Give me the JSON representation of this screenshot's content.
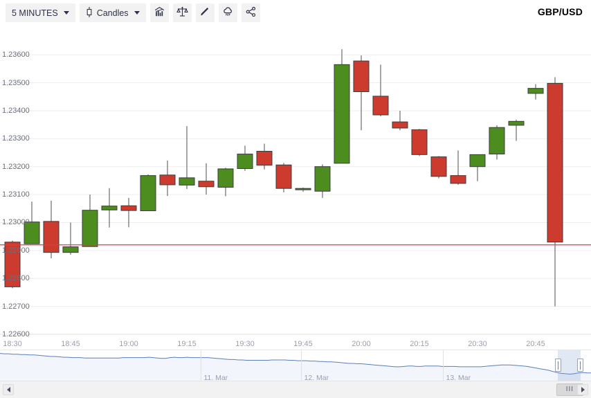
{
  "toolbar": {
    "timeframe_label": "5 MINUTES",
    "chart_type_label": "Candles",
    "chart_type_icon": "candlestick-icon",
    "buttons": [
      {
        "name": "indicators-button",
        "icon": "indicators-chart-icon"
      },
      {
        "name": "compare-button",
        "icon": "balance-scale-icon"
      },
      {
        "name": "draw-button",
        "icon": "pencil-icon"
      },
      {
        "name": "alerts-button",
        "icon": "cloud-rain-icon"
      },
      {
        "name": "share-button",
        "icon": "share-icon"
      }
    ]
  },
  "header": {
    "title": "GBP/USD"
  },
  "navigator": {
    "dates": [
      "11. Mar",
      "12. Mar",
      "13. Mar"
    ],
    "selection_start_pct": 94.4,
    "selection_end_pct": 98.2
  },
  "scrollbar": {
    "left_arrow": "scroll-left-arrow",
    "right_arrow": "scroll-right-arrow",
    "thumb_grip": "III"
  },
  "chart_data": {
    "type": "candlestick",
    "title": "GBP/USD",
    "xlabel": "",
    "ylabel": "",
    "ylim": [
      1.226,
      1.2365
    ],
    "ytick_values": [
      1.236,
      1.235,
      1.234,
      1.233,
      1.232,
      1.231,
      1.23,
      1.229,
      1.228,
      1.227,
      1.226
    ],
    "ytick_labels": [
      "1.23600",
      "1.23500",
      "1.23400",
      "1.23300",
      "1.23200",
      "1.23100",
      "1.23000",
      "1.22900",
      "1.22800",
      "1.22700",
      "1.22600"
    ],
    "xtick_labels": [
      "18:30",
      "18:45",
      "19:00",
      "19:15",
      "19:30",
      "19:45",
      "20:00",
      "20:15",
      "20:30",
      "20:45"
    ],
    "xtick_positions": [
      18,
      102,
      186,
      270,
      354,
      438,
      522,
      606,
      690,
      774
    ],
    "grid": true,
    "legend": false,
    "up_color": "#4d8c1f",
    "down_color": "#cd3a2e",
    "wick_color": "#6b6b6b",
    "border_color": "#3c3c3c",
    "current_price_line": 1.2292,
    "current_price_line_color": "#d4433a",
    "candles": [
      {
        "time": "18:30",
        "open": 1.2293,
        "high": 1.22935,
        "low": 1.22765,
        "close": 1.2277
      },
      {
        "time": "18:35",
        "open": 1.22924,
        "high": 1.23075,
        "low": 1.22924,
        "close": 1.23002
      },
      {
        "time": "18:40",
        "open": 1.23004,
        "high": 1.23078,
        "low": 1.22872,
        "close": 1.22893
      },
      {
        "time": "18:45",
        "open": 1.22893,
        "high": 1.23,
        "low": 1.22885,
        "close": 1.22913
      },
      {
        "time": "18:50",
        "open": 1.22914,
        "high": 1.231,
        "low": 1.22914,
        "close": 1.23044
      },
      {
        "time": "18:55",
        "open": 1.23045,
        "high": 1.23123,
        "low": 1.22982,
        "close": 1.23059
      },
      {
        "time": "19:00",
        "open": 1.2306,
        "high": 1.23088,
        "low": 1.22983,
        "close": 1.23043
      },
      {
        "time": "19:05",
        "open": 1.23042,
        "high": 1.23172,
        "low": 1.23042,
        "close": 1.23168
      },
      {
        "time": "19:10",
        "open": 1.2317,
        "high": 1.23222,
        "low": 1.23095,
        "close": 1.23135
      },
      {
        "time": "19:15",
        "open": 1.23134,
        "high": 1.23345,
        "low": 1.2312,
        "close": 1.2316
      },
      {
        "time": "19:20",
        "open": 1.23148,
        "high": 1.23212,
        "low": 1.231,
        "close": 1.23128
      },
      {
        "time": "19:25",
        "open": 1.23126,
        "high": 1.23196,
        "low": 1.23094,
        "close": 1.23192
      },
      {
        "time": "19:30",
        "open": 1.23193,
        "high": 1.23275,
        "low": 1.23185,
        "close": 1.23245
      },
      {
        "time": "19:35",
        "open": 1.23255,
        "high": 1.23282,
        "low": 1.2319,
        "close": 1.23205
      },
      {
        "time": "19:40",
        "open": 1.23206,
        "high": 1.23213,
        "low": 1.23108,
        "close": 1.23122
      },
      {
        "time": "19:45",
        "open": 1.23118,
        "high": 1.23125,
        "low": 1.2311,
        "close": 1.23122
      },
      {
        "time": "19:50",
        "open": 1.23112,
        "high": 1.23208,
        "low": 1.23088,
        "close": 1.232
      },
      {
        "time": "19:55",
        "open": 1.23212,
        "high": 1.2362,
        "low": 1.23212,
        "close": 1.23565
      },
      {
        "time": "20:00",
        "open": 1.23578,
        "high": 1.23598,
        "low": 1.2333,
        "close": 1.23468
      },
      {
        "time": "20:05",
        "open": 1.23452,
        "high": 1.23565,
        "low": 1.2338,
        "close": 1.23385
      },
      {
        "time": "20:10",
        "open": 1.2336,
        "high": 1.234,
        "low": 1.2333,
        "close": 1.23338
      },
      {
        "time": "20:15",
        "open": 1.23332,
        "high": 1.23335,
        "low": 1.23238,
        "close": 1.23243
      },
      {
        "time": "20:20",
        "open": 1.23235,
        "high": 1.23238,
        "low": 1.23158,
        "close": 1.23165
      },
      {
        "time": "20:25",
        "open": 1.23168,
        "high": 1.23258,
        "low": 1.23135,
        "close": 1.2314
      },
      {
        "time": "20:30",
        "open": 1.232,
        "high": 1.23228,
        "low": 1.23148,
        "close": 1.23243
      },
      {
        "time": "20:35",
        "open": 1.23245,
        "high": 1.23348,
        "low": 1.23225,
        "close": 1.2334
      },
      {
        "time": "20:40",
        "open": 1.23348,
        "high": 1.23368,
        "low": 1.23292,
        "close": 1.23362
      },
      {
        "time": "20:45",
        "open": 1.23462,
        "high": 1.23495,
        "low": 1.2344,
        "close": 1.2348
      },
      {
        "time": "20:50",
        "open": 1.23498,
        "high": 1.2352,
        "low": 1.227,
        "close": 1.2293
      }
    ],
    "navigator_series": {
      "name": "GBP/USD 3-day",
      "y_min": 1.228,
      "y_max": 1.2345,
      "values": [
        1.2344,
        1.2343,
        1.2343,
        1.2342,
        1.2342,
        1.2341,
        1.2341,
        1.234,
        1.234,
        1.2339,
        1.2338,
        1.2337,
        1.2336,
        1.2336,
        1.2335,
        1.2334,
        1.2334,
        1.2333,
        1.2333,
        1.2333,
        1.2332,
        1.2332,
        1.2332,
        1.2332,
        1.2332,
        1.2332,
        1.2332,
        1.2332,
        1.2332,
        1.2333,
        1.2333,
        1.2333,
        1.2333,
        1.2333,
        1.2333,
        1.2334,
        1.2333,
        1.2332,
        1.2331,
        1.2331,
        1.2333,
        1.2334,
        1.2333,
        1.2333,
        1.2334,
        1.2333,
        1.2333,
        1.2333,
        1.2333,
        1.2333,
        1.2332,
        1.2331,
        1.233,
        1.2329,
        1.2328,
        1.2328,
        1.2327,
        1.2327,
        1.2326,
        1.2326,
        1.2326,
        1.2326,
        1.2326,
        1.2326,
        1.2327,
        1.2327,
        1.2327,
        1.2327,
        1.2326,
        1.2326,
        1.2325,
        1.2325,
        1.2325,
        1.2324,
        1.2324,
        1.2323,
        1.2323,
        1.2322,
        1.2322,
        1.2321,
        1.232,
        1.2319,
        1.2318,
        1.2318,
        1.2317,
        1.2317,
        1.2316,
        1.2315,
        1.2314,
        1.2313,
        1.2312,
        1.2311,
        1.231,
        1.2309,
        1.2309,
        1.231,
        1.2311,
        1.2311,
        1.231,
        1.231,
        1.2311,
        1.2311,
        1.2311,
        1.2311,
        1.231,
        1.231,
        1.231,
        1.231,
        1.2309,
        1.2309,
        1.2309,
        1.2309,
        1.2309,
        1.2309,
        1.231,
        1.2311,
        1.2312,
        1.2313,
        1.2314,
        1.2314,
        1.2314,
        1.2313,
        1.2312,
        1.2311,
        1.231,
        1.2308,
        1.2306,
        1.2304,
        1.2302,
        1.23,
        1.2297,
        1.2294,
        1.2292,
        1.2291,
        1.229,
        1.2291,
        1.2293,
        1.2294,
        1.2293,
        1.2293
      ]
    }
  }
}
